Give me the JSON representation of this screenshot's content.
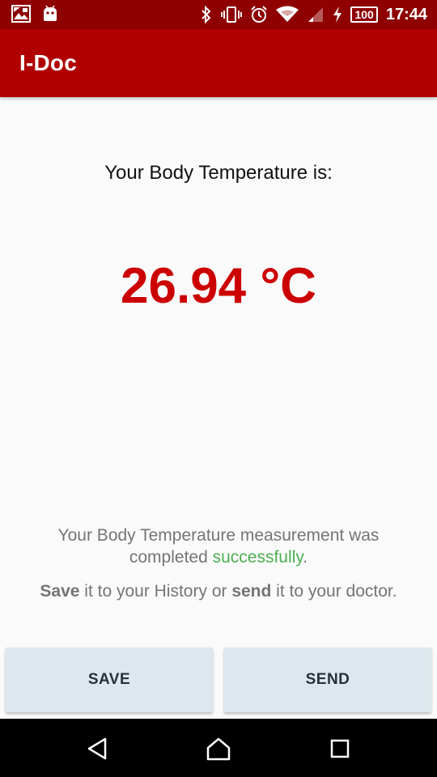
{
  "status_bar": {
    "time": "17:44",
    "battery": "100",
    "icons": [
      "photo-notification-icon",
      "android-notification-icon",
      "bluetooth-icon",
      "vibrate-icon",
      "alarm-icon",
      "wifi-icon",
      "signal-icon",
      "charging-icon",
      "battery-icon"
    ]
  },
  "app_bar": {
    "title": "I-Doc"
  },
  "main": {
    "heading": "Your Body Temperature is:",
    "temperature": "26.94 °C",
    "status_line1": "Your Body Temperature measurement was",
    "status_line2_prefix": "completed ",
    "status_success_word": "successfully",
    "status_line2_suffix": ".",
    "hint_save": "Save",
    "hint_mid": " it to your History or ",
    "hint_send": "send",
    "hint_end": " it to your doctor."
  },
  "buttons": {
    "save_label": "SAVE",
    "send_label": "SEND"
  },
  "colors": {
    "status_bar": "#8f0000",
    "app_bar": "#b00000",
    "temperature": "#cc0000",
    "success": "#4caf50",
    "button_bg": "#dde8ee"
  },
  "nav_bar": {
    "icons": [
      "back-icon",
      "home-icon",
      "recent-apps-icon"
    ]
  }
}
